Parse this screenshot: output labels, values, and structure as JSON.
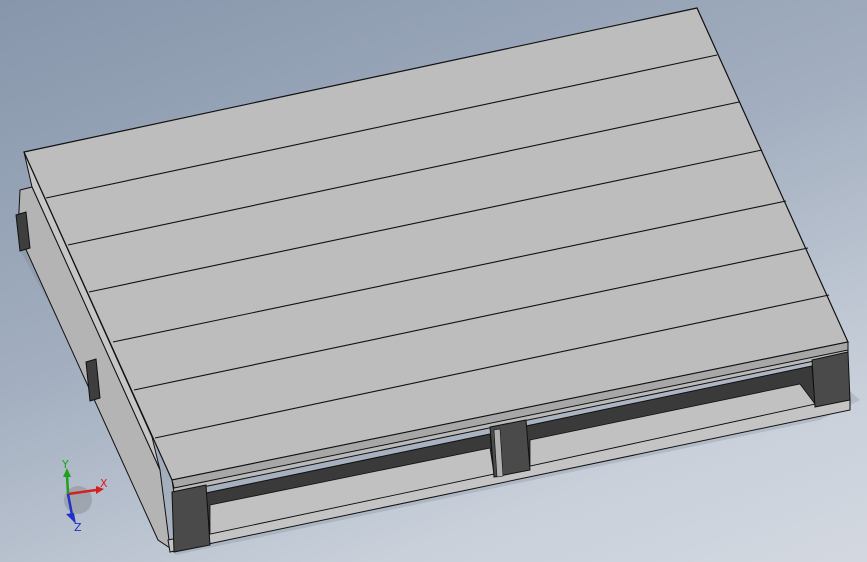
{
  "viewport": {
    "background_top": "#8796ab",
    "background_bottom": "#d3d8e0"
  },
  "model": {
    "name": "",
    "edge_color": "#111111",
    "top_face_color": "#bdbdbd",
    "side_face_color": "#a9a9a9",
    "dark_face_color": "#4a4a4a",
    "board_count": 7,
    "block_count_front": 3
  },
  "triad": {
    "x_label": "X",
    "y_label": "Y",
    "z_label": "Z",
    "x_color": "#d42020",
    "y_color": "#1fa11f",
    "z_color": "#2030c8"
  }
}
